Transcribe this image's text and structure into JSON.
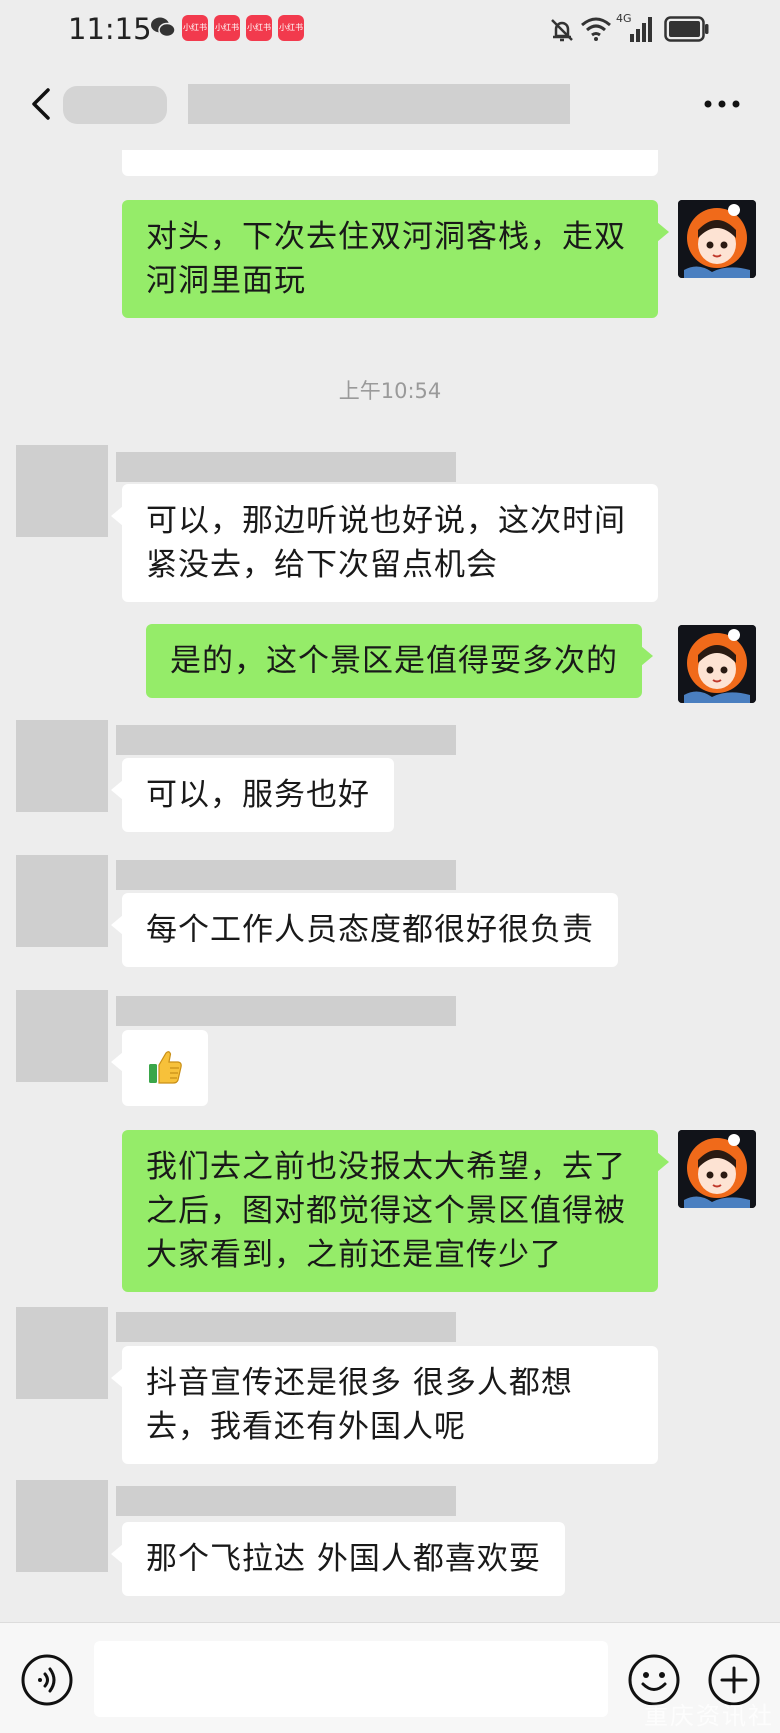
{
  "status_bar": {
    "time": "11:15",
    "badges": [
      "小红书",
      "小红书",
      "小红书",
      "小红书"
    ],
    "network": "4G"
  },
  "chat": {
    "timestamp": "上午10:54",
    "messages": [
      {
        "from": "me",
        "text": "对头，下次去住双河洞客栈，走双河洞里面玩"
      },
      {
        "from": "other",
        "text": "可以，那边听说也好说，这次时间紧没去，给下次留点机会"
      },
      {
        "from": "me",
        "text": "是的，这个景区是值得耍多次的"
      },
      {
        "from": "other",
        "text": "可以，服务也好"
      },
      {
        "from": "other",
        "text": "每个工作人员态度都很好很负责"
      },
      {
        "from": "other",
        "text": "👍"
      },
      {
        "from": "me",
        "text": "我们去之前也没报太大希望，去了之后，图对都觉得这个景区值得被大家看到，之前还是宣传少了"
      },
      {
        "from": "other",
        "text": "抖音宣传还是很多 很多人都想去，我看还有外国人呢"
      },
      {
        "from": "other",
        "text": "那个飞拉达 外国人都喜欢耍"
      }
    ]
  },
  "input_bar": {
    "placeholder": ""
  },
  "watermark": "重庆资讯社",
  "colors": {
    "background": "#ededed",
    "outgoing_bubble": "#95ec69",
    "incoming_bubble": "#ffffff",
    "badge": "#f23a4d"
  }
}
